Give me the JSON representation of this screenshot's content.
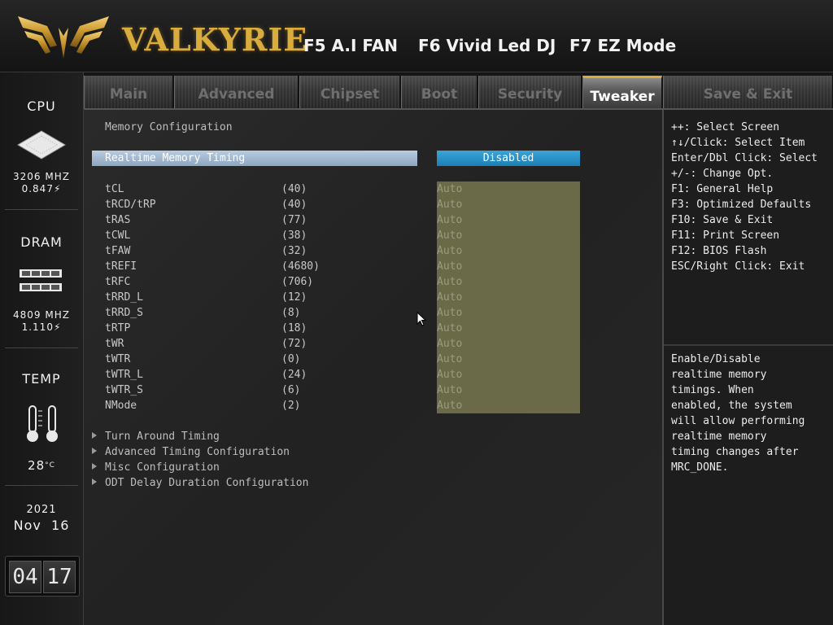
{
  "header": {
    "brand": "VALKYRIE",
    "hotkeys": {
      "fan": "F5 A.I FAN",
      "led": "F6 Vivid Led DJ",
      "ez": "F7 EZ Mode"
    }
  },
  "sidebar": {
    "cpu": {
      "title": "CPU",
      "freq": "3206 MHZ",
      "volt": "0.847"
    },
    "dram": {
      "title": "DRAM",
      "freq": "4809 MHZ",
      "volt": "1.110"
    },
    "temp": {
      "title": "TEMP",
      "value": "28"
    },
    "date": {
      "year": "2021",
      "day": "Nov  16"
    },
    "clock": {
      "hour": "04",
      "minute": "17"
    }
  },
  "tabs": [
    {
      "label": "Main",
      "active": false
    },
    {
      "label": "Advanced",
      "active": false
    },
    {
      "label": "Chipset",
      "active": false
    },
    {
      "label": "Boot",
      "active": false
    },
    {
      "label": "Security",
      "active": false
    },
    {
      "label": "Tweaker",
      "active": true
    },
    {
      "label": "Save & Exit",
      "active": false
    }
  ],
  "main": {
    "section_title": "Memory Configuration",
    "selected_item": {
      "label": "Realtime Memory Timing",
      "value": "Disabled"
    },
    "timings": [
      {
        "name": "tCL",
        "value": "(40)",
        "setting": "Auto"
      },
      {
        "name": "tRCD/tRP",
        "value": "(40)",
        "setting": "Auto"
      },
      {
        "name": "tRAS",
        "value": "(77)",
        "setting": "Auto"
      },
      {
        "name": "tCWL",
        "value": "(38)",
        "setting": "Auto"
      },
      {
        "name": "tFAW",
        "value": "(32)",
        "setting": "Auto"
      },
      {
        "name": "tREFI",
        "value": "(4680)",
        "setting": "Auto"
      },
      {
        "name": "tRFC",
        "value": "(706)",
        "setting": "Auto"
      },
      {
        "name": "tRRD_L",
        "value": "(12)",
        "setting": "Auto"
      },
      {
        "name": "tRRD_S",
        "value": "(8)",
        "setting": "Auto"
      },
      {
        "name": "tRTP",
        "value": "(18)",
        "setting": "Auto"
      },
      {
        "name": "tWR",
        "value": "(72)",
        "setting": "Auto"
      },
      {
        "name": "tWTR",
        "value": "(0)",
        "setting": "Auto"
      },
      {
        "name": "tWTR_L",
        "value": "(24)",
        "setting": "Auto"
      },
      {
        "name": "tWTR_S",
        "value": "(6)",
        "setting": "Auto"
      },
      {
        "name": "NMode",
        "value": "(2)",
        "setting": "Auto"
      }
    ],
    "submenus": [
      "Turn Around Timing",
      "Advanced Timing Configuration",
      "Misc Configuration",
      "ODT Delay Duration Configuration"
    ]
  },
  "help": {
    "keys": [
      "++: Select Screen",
      "↑↓/Click: Select Item",
      "Enter/Dbl Click: Select",
      "+/-: Change Opt.",
      "F1: General Help",
      "F3: Optimized Defaults",
      "F10: Save & Exit",
      "F11: Print Screen",
      "F12: BIOS Flash",
      "ESC/Right Click: Exit"
    ],
    "description": [
      "Enable/Disable",
      "realtime memory",
      "timings. When",
      "enabled, the system",
      "will allow performing",
      "realtime memory",
      "timing changes after",
      "MRC_DONE."
    ]
  },
  "colors": {
    "accent_gold": "#d9ac3e",
    "selected_value": "#2b92c8",
    "auto_block": "#6a6a48",
    "highlight_row": "#a9bdd4"
  }
}
